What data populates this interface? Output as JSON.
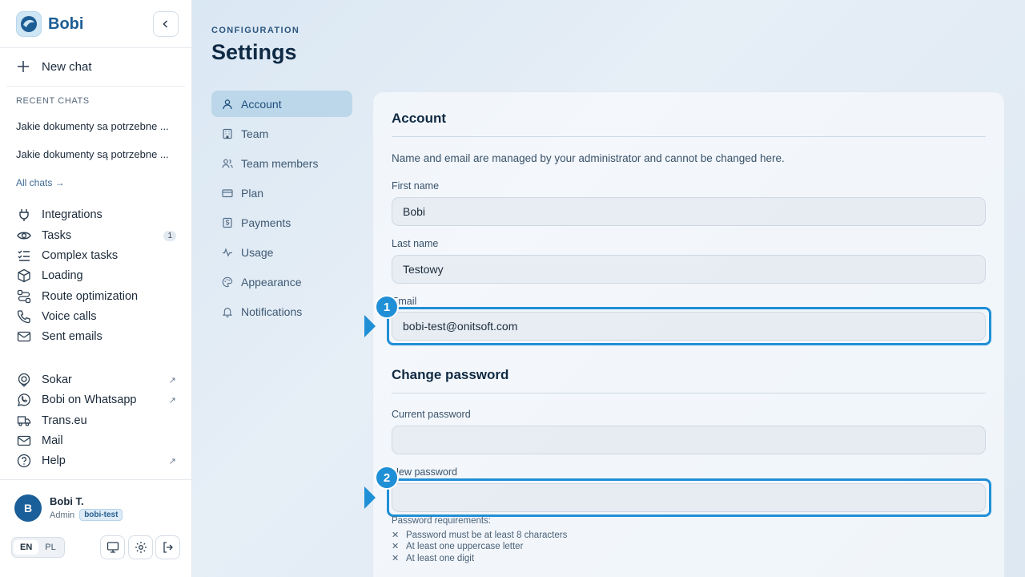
{
  "brand": {
    "name": "Bobi"
  },
  "sidebar": {
    "new_chat": "New chat",
    "recent_title": "RECENT CHATS",
    "recent_chats": [
      "Jakie dokumenty sa potrzebne ...",
      "Jakie dokumenty są potrzebne ..."
    ],
    "all_chats": "All chats →",
    "nav": [
      {
        "label": "Integrations",
        "icon": "plug-icon"
      },
      {
        "label": "Tasks",
        "icon": "eye-icon",
        "badge": "1"
      },
      {
        "label": "Complex tasks",
        "icon": "list-check-icon"
      },
      {
        "label": "Loading",
        "icon": "box-icon"
      },
      {
        "label": "Route optimization",
        "icon": "route-icon"
      },
      {
        "label": "Voice calls",
        "icon": "phone-icon"
      },
      {
        "label": "Sent emails",
        "icon": "mail-icon"
      }
    ],
    "links": [
      {
        "label": "Sokar",
        "icon": "sokar-icon",
        "ext": "↗"
      },
      {
        "label": "Bobi on Whatsapp",
        "icon": "whatsapp-icon",
        "ext": "↗"
      },
      {
        "label": "Trans.eu",
        "icon": "truck-icon"
      },
      {
        "label": "Mail",
        "icon": "mail-icon"
      },
      {
        "label": "Help",
        "icon": "help-icon",
        "ext": "↗"
      }
    ],
    "user": {
      "initial": "B",
      "name": "Bobi T.",
      "role": "Admin",
      "tag": "bobi-test"
    },
    "lang": {
      "en": "EN",
      "pl": "PL"
    }
  },
  "main": {
    "eyebrow": "CONFIGURATION",
    "title": "Settings",
    "menu": [
      {
        "label": "Account",
        "icon": "user-icon"
      },
      {
        "label": "Team",
        "icon": "building-icon"
      },
      {
        "label": "Team members",
        "icon": "users-icon"
      },
      {
        "label": "Plan",
        "icon": "card-icon"
      },
      {
        "label": "Payments",
        "icon": "dollar-icon"
      },
      {
        "label": "Usage",
        "icon": "activity-icon"
      },
      {
        "label": "Appearance",
        "icon": "palette-icon"
      },
      {
        "label": "Notifications",
        "icon": "bell-icon"
      }
    ],
    "account": {
      "heading": "Account",
      "description": "Name and email are managed by your administrator and cannot be changed here.",
      "first_name_label": "First name",
      "first_name": "Bobi",
      "last_name_label": "Last name",
      "last_name": "Testowy",
      "email_label": "Email",
      "email": "bobi-test@onitsoft.com"
    },
    "password": {
      "heading": "Change password",
      "current_label": "Current password",
      "current_value": "",
      "new_label": "New password",
      "new_value": "",
      "requirements_title": "Password requirements:",
      "requirements": [
        "Password must be at least 8 characters",
        "At least one uppercase letter",
        "At least one digit"
      ]
    },
    "highlights": [
      "1",
      "2"
    ]
  },
  "colors": {
    "accent": "#1f8fd6",
    "brand": "#1c5d94"
  }
}
